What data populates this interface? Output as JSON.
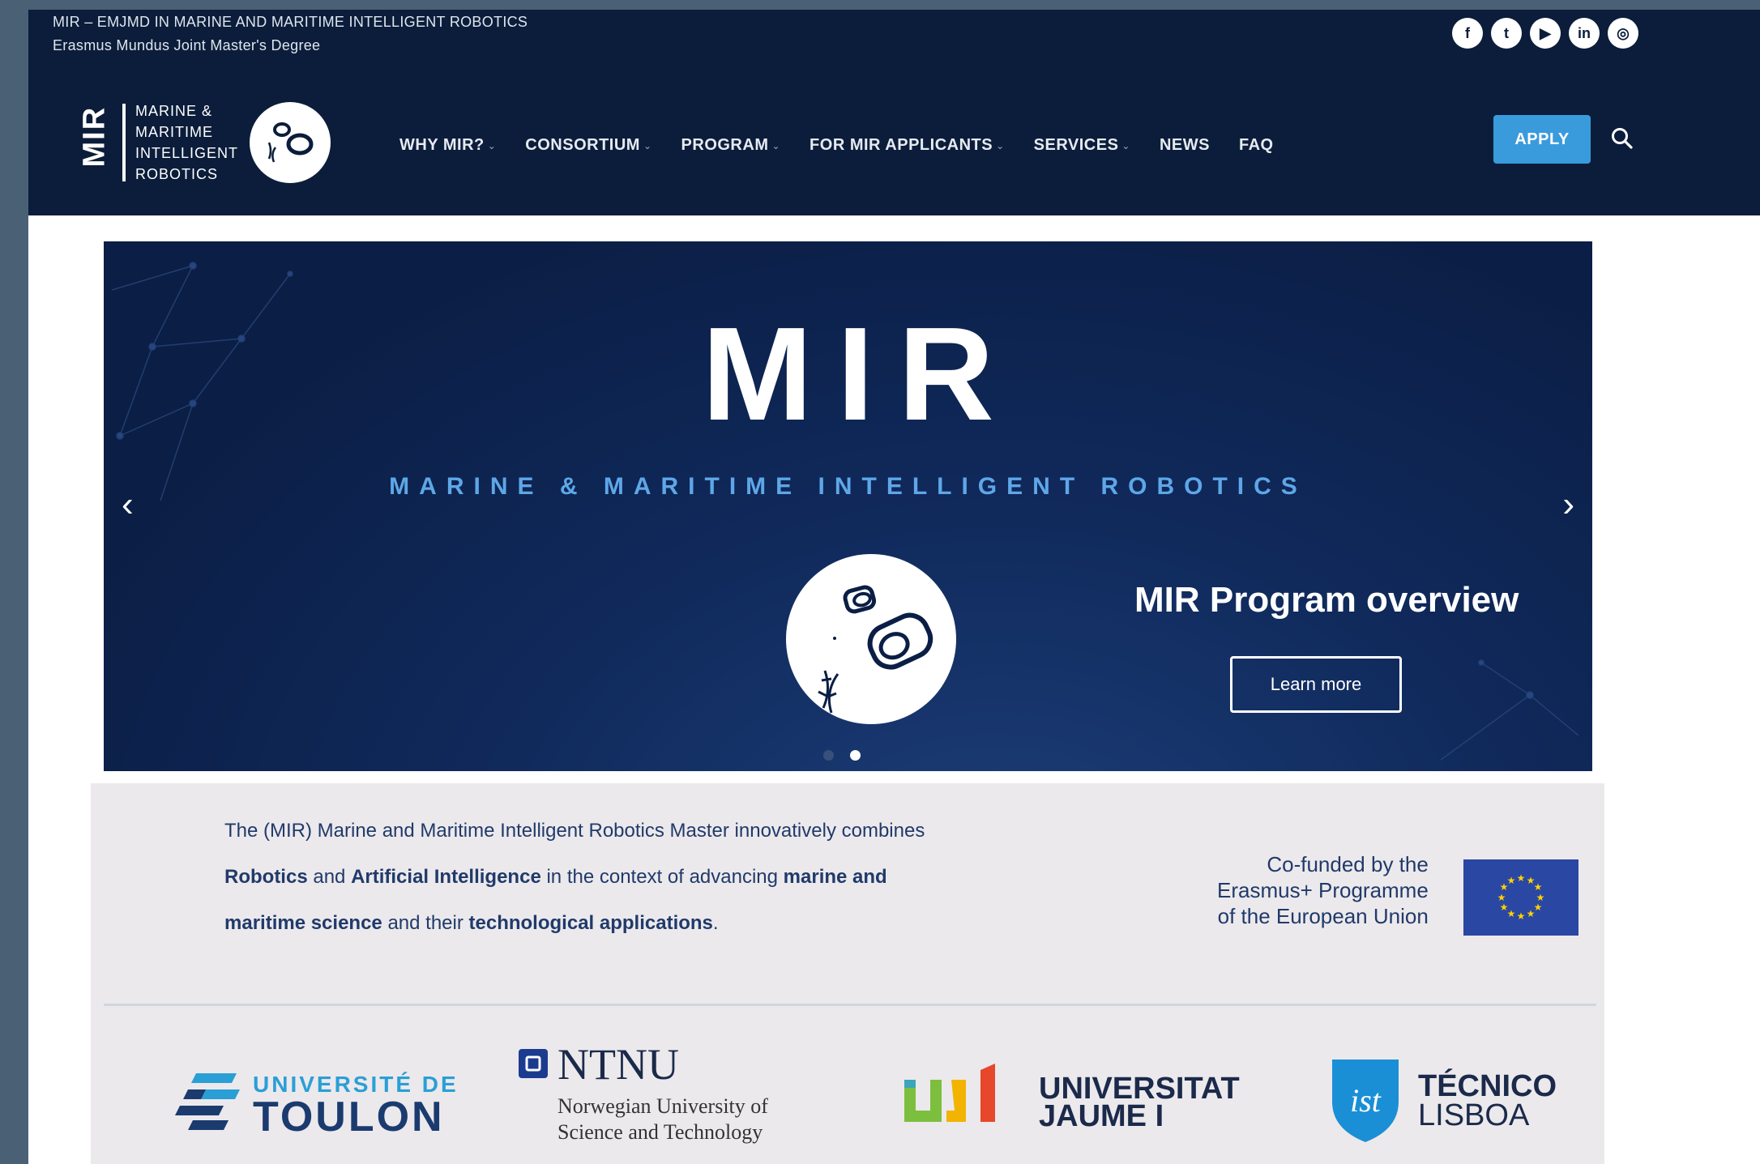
{
  "top_bar": {
    "title": "MIR – EMJMD IN MARINE AND MARITIME INTELLIGENT ROBOTICS",
    "subtitle": "Erasmus Mundus Joint Master's Degree",
    "social": [
      "f",
      "t",
      "▶",
      "in",
      "◎"
    ]
  },
  "logo": {
    "mark": "MIR",
    "lines": [
      "MARINE &",
      "MARITIME",
      "INTELLIGENT",
      "ROBOTICS"
    ]
  },
  "nav": [
    {
      "label": "WHY MIR?",
      "dropdown": true
    },
    {
      "label": "CONSORTIUM",
      "dropdown": true
    },
    {
      "label": "PROGRAM",
      "dropdown": true
    },
    {
      "label": "FOR MIR APPLICANTS",
      "dropdown": true
    },
    {
      "label": "SERVICES",
      "dropdown": true
    },
    {
      "label": "NEWS",
      "dropdown": false
    },
    {
      "label": "FAQ",
      "dropdown": false
    }
  ],
  "apply_label": "APPLY",
  "hero": {
    "title": "MIR",
    "subtitle": "MARINE & MARITIME INTELLIGENT ROBOTICS",
    "caption": "MIR Program overview",
    "button": "Learn more",
    "prev": "‹",
    "next": "›",
    "slides": 2,
    "active_slide": 2
  },
  "intro": {
    "line1": "The (MIR) Marine and Maritime Intelligent Robotics Master innovatively combines",
    "line2_a": "Robotics",
    "line2_b": " and ",
    "line2_c": "Artificial Intelligence",
    "line2_d": " in the context of advancing ",
    "line2_e": "marine and",
    "line3_a": "maritime science",
    "line3_b": " and their ",
    "line3_c": "technological applications",
    "line3_d": "."
  },
  "cofund": {
    "line1": "Co-funded by the",
    "line2": "Erasmus+ Programme",
    "line3": "of the European Union"
  },
  "partners": {
    "toulon": {
      "line1": "UNIVERSITÉ DE",
      "line2": "TOULON"
    },
    "ntnu": {
      "name": "NTNU",
      "line1": "Norwegian University of",
      "line2": "Science and Technology"
    },
    "uji": {
      "line1": "UNIVERSITAT",
      "line2": "JAUME I"
    },
    "tecnico": {
      "line1": "TÉCNICO",
      "line2": "LISBOA"
    }
  },
  "colors": {
    "header_bg": "#0b1d3a",
    "accent": "#3a9bdc",
    "hero_subtitle": "#5ea7e8",
    "text_blue": "#203a6a",
    "intro_bg": "#ece9ec"
  }
}
